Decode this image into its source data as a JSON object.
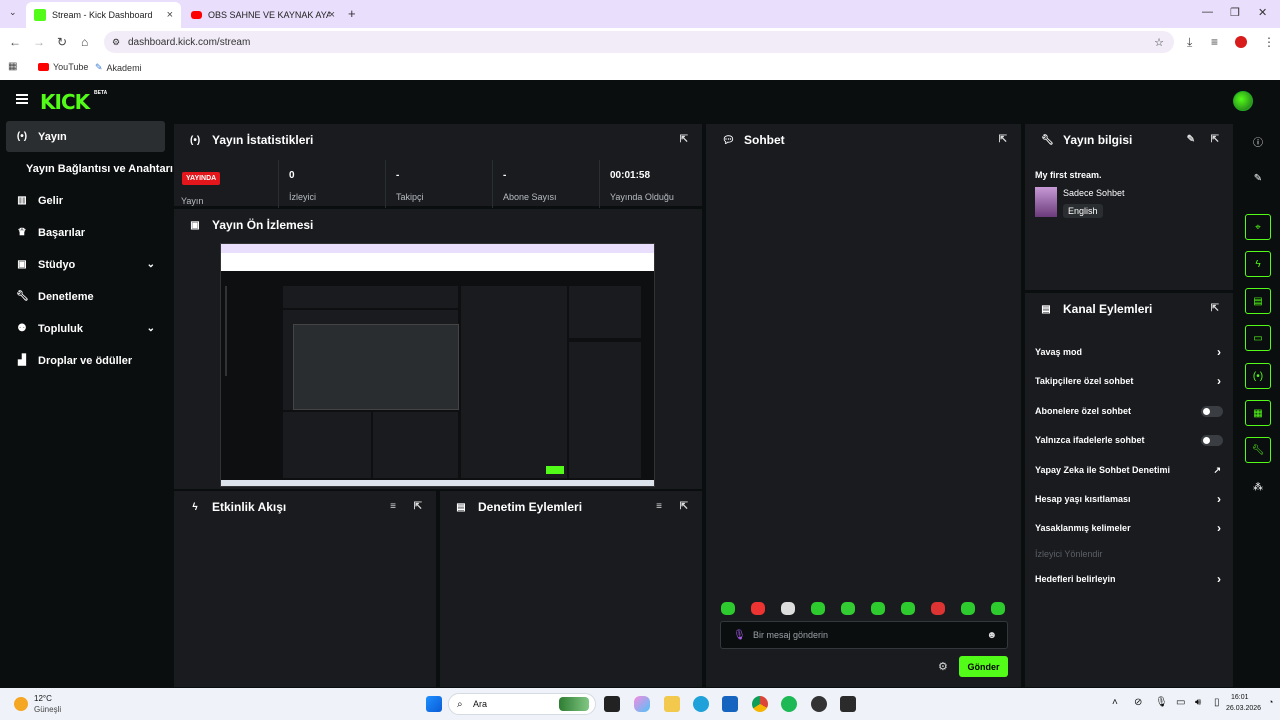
{
  "browser": {
    "tabs": [
      {
        "title": "Stream - Kick Dashboard"
      },
      {
        "title": "OBS SAHNE VE KAYNAK AYARLA"
      }
    ],
    "url": "dashboard.kick.com/stream",
    "bookmarks": [
      "YouTube",
      "Akademi"
    ]
  },
  "colors": {
    "accent": "#53fc18",
    "live": "#e3161c",
    "panel": "#191b1f",
    "background": "#0b0e0f"
  },
  "sidebar": {
    "items": [
      {
        "label": "Yayın",
        "icon": "stream-icon"
      },
      {
        "label": "Yayın Bağlantısı ve Anahtarı"
      },
      {
        "label": "Gelir",
        "icon": "revenue-icon"
      },
      {
        "label": "Başarılar",
        "icon": "trophy-icon"
      },
      {
        "label": "Stüdyo",
        "icon": "studio-icon"
      },
      {
        "label": "Denetleme",
        "icon": "wrench-icon"
      },
      {
        "label": "Topluluk",
        "icon": "community-icon"
      },
      {
        "label": "Droplar ve ödüller",
        "icon": "drops-icon"
      }
    ]
  },
  "stats": {
    "title": "Yayın İstatistikleri",
    "live_badge": "YAYINDA",
    "live_label": "Yayın",
    "items": [
      {
        "value": "0",
        "label": "İzleyici"
      },
      {
        "value": "-",
        "label": "Takipçi"
      },
      {
        "value": "-",
        "label": "Abone Sayısı"
      },
      {
        "value": "00:01:58",
        "label": "Yayında Olduğu"
      }
    ]
  },
  "preview": {
    "title": "Yayın Ön İzlemesi"
  },
  "activity": {
    "title": "Etkinlik Akışı"
  },
  "moderation": {
    "title": "Denetim Eylemleri"
  },
  "chat": {
    "title": "Sohbet",
    "input_placeholder": "Bir mesaj gönderin",
    "send_label": "Gönder"
  },
  "stream_info": {
    "title": "Yayın bilgisi",
    "stream_title": "My first stream.",
    "category": "Sadece Sohbet",
    "language": "English"
  },
  "channel_actions": {
    "title": "Kanal Eylemleri",
    "items": [
      {
        "label": "Yavaş mod",
        "control": "chevron"
      },
      {
        "label": "Takipçilere özel sohbet",
        "control": "chevron"
      },
      {
        "label": "Abonelere özel sohbet",
        "control": "toggle",
        "on": false
      },
      {
        "label": "Yalnızca ifadelerle sohbet",
        "control": "toggle",
        "on": false
      },
      {
        "label": "Yapay Zeka ile Sohbet Denetimi",
        "control": "external"
      },
      {
        "label": "Hesap yaşı kısıtlaması",
        "control": "chevron"
      },
      {
        "label": "Yasaklanmış kelimeler",
        "control": "chevron"
      },
      {
        "label": "İzleyici Yönlendir",
        "control": "none",
        "disabled": true
      },
      {
        "label": "Hedefleri belirleyin",
        "control": "chevron"
      }
    ]
  },
  "taskbar": {
    "weather_temp": "12°C",
    "weather_desc": "Güneşli",
    "search": "Ara",
    "time": "16:01",
    "date": "26.03.2026"
  }
}
